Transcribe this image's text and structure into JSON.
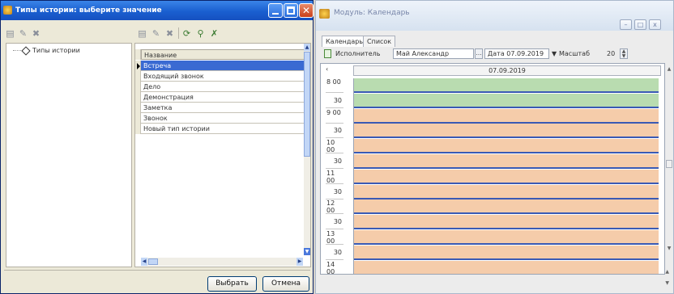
{
  "dialog": {
    "title": "Типы истории: выберите значение",
    "tree": {
      "root_label": "Типы истории"
    },
    "grid": {
      "header": "Название",
      "rows": [
        "Встреча",
        "Входящий звонок",
        "Дело",
        "Демонстрация",
        "Заметка",
        "Звонок",
        "Новый тип истории"
      ],
      "selected_index": 0
    },
    "buttons": {
      "select": "Выбрать",
      "cancel": "Отмена"
    }
  },
  "calendar": {
    "title": "Модуль: Календарь",
    "window_buttons": {
      "min": "–",
      "max": "□",
      "close": "x"
    },
    "tabs": [
      {
        "label": "Календарь",
        "active": true
      },
      {
        "label": "Список",
        "active": false
      }
    ],
    "toolbar": {
      "executor_label": "Исполнитель",
      "executor_value": "Май Александр",
      "date_label": "Дата",
      "date_value": "07.09.2019",
      "scale_label": "Масштаб",
      "scale_value": "20"
    },
    "day_header": "07.09.2019",
    "times": [
      "8 00",
      "30",
      "9 00",
      "30",
      "10 00",
      "30",
      "11 00",
      "30",
      "12 00",
      "30",
      "13 00",
      "30",
      "14 00"
    ],
    "slot_colors": {
      "free": "#b9dcb0",
      "busy": "#f5ccaa"
    },
    "slots": [
      "free",
      "free",
      "busy",
      "busy",
      "busy",
      "busy",
      "busy",
      "busy",
      "busy",
      "busy",
      "busy",
      "busy",
      "busy"
    ]
  },
  "colors": {
    "title_bar": "#1a5fd0",
    "selection": "#3a6ad2",
    "slot_line": "#3a5ab4"
  }
}
